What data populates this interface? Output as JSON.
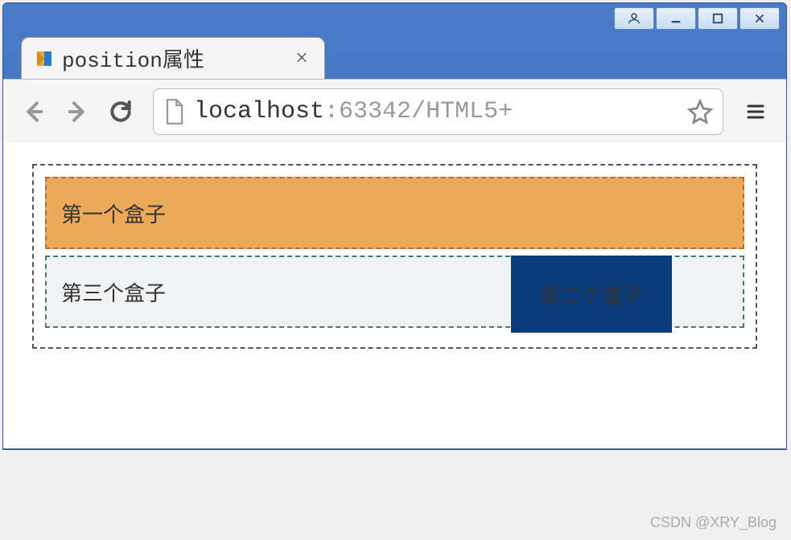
{
  "window": {
    "user_btn": "user",
    "min_btn": "minimize",
    "max_btn": "maximize",
    "close_btn": "close"
  },
  "tab": {
    "title": "position属性",
    "close": "×"
  },
  "toolbar": {
    "back": "back",
    "forward": "forward",
    "reload": "reload",
    "menu": "menu"
  },
  "url": {
    "host": "localhost",
    "port": ":63342",
    "path": "/HTML5+"
  },
  "content": {
    "box1": "第一个盒子",
    "box2": "第二个盒子",
    "box3": "第三个盒子"
  },
  "watermark": "CSDN @XRY_Blog"
}
